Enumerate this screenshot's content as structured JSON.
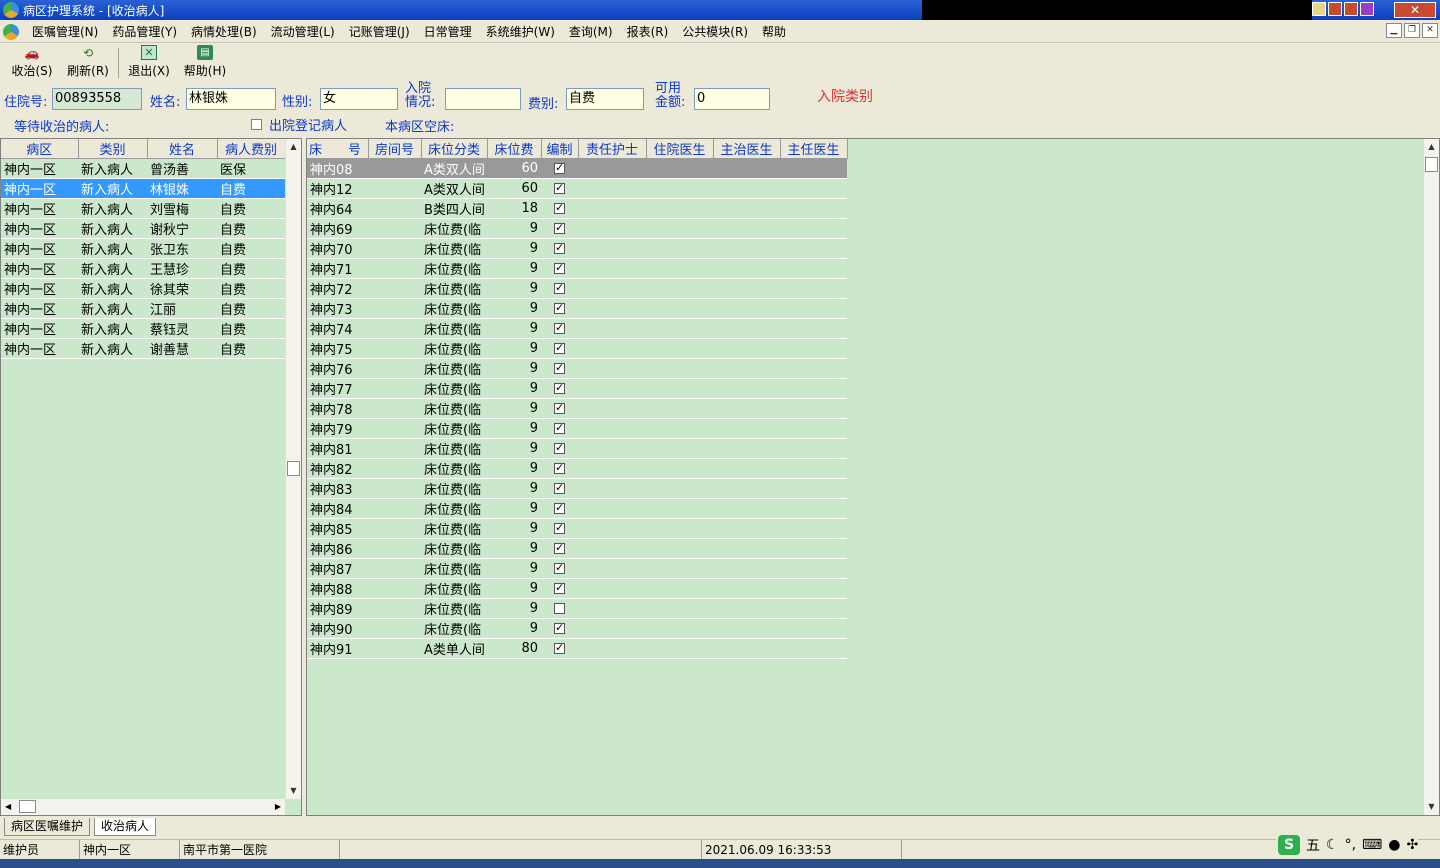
{
  "window": {
    "title": "病区护理系统 - [收治病人]",
    "close_label": "✕"
  },
  "menu": [
    "医嘱管理(N)",
    "药品管理(Y)",
    "病情处理(B)",
    "流动管理(L)",
    "记账管理(J)",
    "日常管理",
    "系统维护(W)",
    "查询(M)",
    "报表(R)",
    "公共模块(R)",
    "帮助"
  ],
  "toolbar": {
    "admit": "收治(S)",
    "refresh": "刷新(R)",
    "exit": "退出(X)",
    "help": "帮助(H)"
  },
  "form": {
    "admission_no_label": "住院号:",
    "admission_no": "00893558",
    "name_label": "姓名:",
    "name": "林银姝",
    "gender_label": "性别:",
    "gender": "女",
    "admit_status_label": "入院\n情况:",
    "admit_status": "",
    "fee_type_label": "费别:",
    "fee_type": "自费",
    "available_amount_label": "可用\n金额:",
    "available_amount": "0",
    "admit_category_note": "入院类别",
    "waiting_label": "等待收治的病人:",
    "discharge_checkbox_label": "出院登记病人",
    "empty_beds_label": "本病区空床:"
  },
  "waiting_table": {
    "headers": [
      "病区",
      "类别",
      "姓名",
      "病人费别"
    ],
    "rows": [
      [
        "神内一区",
        "新入病人",
        "曾汤善",
        "医保"
      ],
      [
        "神内一区",
        "新入病人",
        "林银姝",
        "自费"
      ],
      [
        "神内一区",
        "新入病人",
        "刘雪梅",
        "自费"
      ],
      [
        "神内一区",
        "新入病人",
        "谢秋宁",
        "自费"
      ],
      [
        "神内一区",
        "新入病人",
        "张卫东",
        "自费"
      ],
      [
        "神内一区",
        "新入病人",
        "王慧珍",
        "自费"
      ],
      [
        "神内一区",
        "新入病人",
        "徐其荣",
        "自费"
      ],
      [
        "神内一区",
        "新入病人",
        "江丽",
        "自费"
      ],
      [
        "神内一区",
        "新入病人",
        "蔡钰灵",
        "自费"
      ],
      [
        "神内一区",
        "新入病人",
        "谢善慧",
        "自费"
      ]
    ],
    "selected_index": 1
  },
  "beds_table": {
    "headers": [
      "床　　号",
      "房间号",
      "床位分类",
      "床位费",
      "编制",
      "责任护士",
      "住院医生",
      "主治医生",
      "主任医生"
    ],
    "rows": [
      {
        "bed": "神内08",
        "room": "",
        "type": "A类双人间",
        "fee": "60",
        "staffed": true
      },
      {
        "bed": "神内12",
        "room": "",
        "type": "A类双人间",
        "fee": "60",
        "staffed": true
      },
      {
        "bed": "神内64",
        "room": "",
        "type": "B类四人间",
        "fee": "18",
        "staffed": true
      },
      {
        "bed": "神内69",
        "room": "",
        "type": "床位费(临",
        "fee": "9",
        "staffed": true
      },
      {
        "bed": "神内70",
        "room": "",
        "type": "床位费(临",
        "fee": "9",
        "staffed": true
      },
      {
        "bed": "神内71",
        "room": "",
        "type": "床位费(临",
        "fee": "9",
        "staffed": true
      },
      {
        "bed": "神内72",
        "room": "",
        "type": "床位费(临",
        "fee": "9",
        "staffed": true
      },
      {
        "bed": "神内73",
        "room": "",
        "type": "床位费(临",
        "fee": "9",
        "staffed": true
      },
      {
        "bed": "神内74",
        "room": "",
        "type": "床位费(临",
        "fee": "9",
        "staffed": true
      },
      {
        "bed": "神内75",
        "room": "",
        "type": "床位费(临",
        "fee": "9",
        "staffed": true
      },
      {
        "bed": "神内76",
        "room": "",
        "type": "床位费(临",
        "fee": "9",
        "staffed": true
      },
      {
        "bed": "神内77",
        "room": "",
        "type": "床位费(临",
        "fee": "9",
        "staffed": true
      },
      {
        "bed": "神内78",
        "room": "",
        "type": "床位费(临",
        "fee": "9",
        "staffed": true
      },
      {
        "bed": "神内79",
        "room": "",
        "type": "床位费(临",
        "fee": "9",
        "staffed": true
      },
      {
        "bed": "神内81",
        "room": "",
        "type": "床位费(临",
        "fee": "9",
        "staffed": true
      },
      {
        "bed": "神内82",
        "room": "",
        "type": "床位费(临",
        "fee": "9",
        "staffed": true
      },
      {
        "bed": "神内83",
        "room": "",
        "type": "床位费(临",
        "fee": "9",
        "staffed": true
      },
      {
        "bed": "神内84",
        "room": "",
        "type": "床位费(临",
        "fee": "9",
        "staffed": true
      },
      {
        "bed": "神内85",
        "room": "",
        "type": "床位费(临",
        "fee": "9",
        "staffed": true
      },
      {
        "bed": "神内86",
        "room": "",
        "type": "床位费(临",
        "fee": "9",
        "staffed": true
      },
      {
        "bed": "神内87",
        "room": "",
        "type": "床位费(临",
        "fee": "9",
        "staffed": true
      },
      {
        "bed": "神内88",
        "room": "",
        "type": "床位费(临",
        "fee": "9",
        "staffed": true
      },
      {
        "bed": "神内89",
        "room": "",
        "type": "床位费(临",
        "fee": "9",
        "staffed": false
      },
      {
        "bed": "神内90",
        "room": "",
        "type": "床位费(临",
        "fee": "9",
        "staffed": true
      },
      {
        "bed": "神内91",
        "room": "",
        "type": "A类单人间",
        "fee": "80",
        "staffed": true
      }
    ],
    "selected_index": 0
  },
  "tabs": [
    "病区医嘱维护",
    "收治病人"
  ],
  "status": {
    "user": "维护员",
    "ward": "神内一区",
    "hospital": "南平市第一医院",
    "datetime": "2021.06.09 16:33:53"
  },
  "ime": {
    "mode": "五"
  },
  "colors": {
    "grid_bg": "#CCE8CC",
    "label_blue": "#0C38C8",
    "note_red": "#E03030",
    "selection": "#3399FF"
  }
}
